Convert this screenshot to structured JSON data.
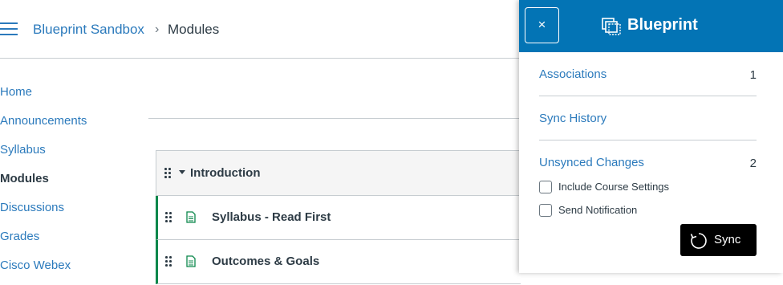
{
  "breadcrumb": {
    "course": "Blueprint Sandbox",
    "separator": "›",
    "current": "Modules"
  },
  "nav": {
    "items": [
      {
        "label": "Home"
      },
      {
        "label": "Announcements"
      },
      {
        "label": "Syllabus"
      },
      {
        "label": "Modules",
        "active": true
      },
      {
        "label": "Discussions"
      },
      {
        "label": "Grades"
      },
      {
        "label": "Cisco Webex"
      }
    ]
  },
  "module": {
    "title": "Introduction",
    "items": [
      {
        "title": "Syllabus - Read First",
        "icon": "page-icon"
      },
      {
        "title": "Outcomes & Goals",
        "icon": "page-icon"
      }
    ]
  },
  "tray": {
    "close_label": "×",
    "title": "Blueprint",
    "associations": {
      "label": "Associations",
      "count": "1"
    },
    "sync_history": {
      "label": "Sync History"
    },
    "unsynced": {
      "label": "Unsynced Changes",
      "count": "2"
    },
    "include_course_settings": "Include Course Settings",
    "send_notification": "Send Notification",
    "sync_label": "Sync"
  },
  "colors": {
    "link": "#2b7abc",
    "tray_header": "#0374b5",
    "published": "#0b874b",
    "sync_button": "#000000"
  }
}
